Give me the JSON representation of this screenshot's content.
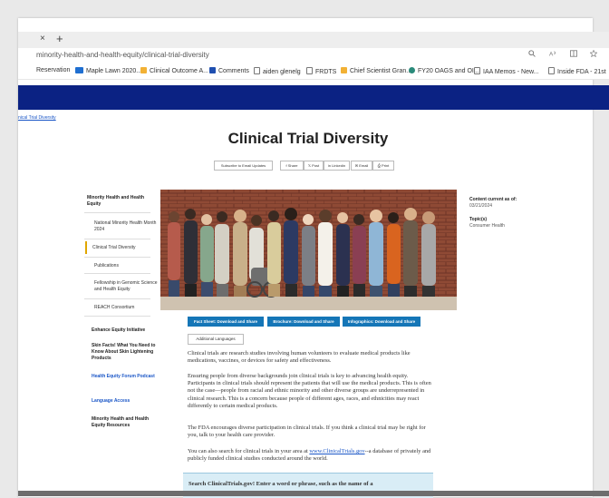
{
  "browser": {
    "close_glyph": "×",
    "new_tab_glyph": "+",
    "url": "minority-health-and-health-equity/clinical-trial-diversity",
    "toolbar_icons": [
      "search-icon",
      "read-aloud-icon",
      "split-screen-icon",
      "favorite-icon"
    ],
    "bookmarks": [
      {
        "label": "Reservation",
        "icon": "none",
        "color": ""
      },
      {
        "label": "Maple Lawn 2020...",
        "icon": "su-icon",
        "color": "#1f6fd1"
      },
      {
        "label": "Clinical Outcome A...",
        "icon": "folder-icon",
        "color": "#f2b134"
      },
      {
        "label": "Comments",
        "icon": "doc-icon",
        "color": "#1f4fb0"
      },
      {
        "label": "aiden glenelg",
        "icon": "page-icon",
        "color": "#777777"
      },
      {
        "label": "FRDTS",
        "icon": "page-icon",
        "color": "#777777"
      },
      {
        "label": "Chief Scientist Gran...",
        "icon": "folder-icon",
        "color": "#f2b134"
      },
      {
        "label": "FY20 OAGS and OI...",
        "icon": "app-icon",
        "color": "#2a8a7a"
      },
      {
        "label": "IAA Memos - New...",
        "icon": "page-icon",
        "color": "#777777"
      },
      {
        "label": "Inside FDA - 21st",
        "icon": "page-icon",
        "color": "#777777"
      }
    ]
  },
  "page": {
    "breadcrumb": "nical Trial Diversity",
    "title": "Clinical Trial Diversity",
    "share_buttons": {
      "subscribe": "Subscribe to Email Updates",
      "share": "Share",
      "post": "Post",
      "linkedin": "Linkedin",
      "email": "Email",
      "print": "Print"
    },
    "sidenav": {
      "section_title": "Minority Health and Health Equity",
      "items": [
        "National Minority Health Month 2024",
        "Clinical Trial Diversity",
        "Publications",
        "Fellowship in Genomic Science and Health Equity",
        "REACH Consortium"
      ],
      "links": [
        "Enhance Equity Initiative",
        "Skin Facts! What You Need to Know About Skin Lightening Products",
        "Health Equity Forum Podcast",
        "Language Access",
        "Minority Health and Health Equity Resources"
      ]
    },
    "meta": {
      "content_current_label": "Content current as of:",
      "content_current_date": "03/21/2024",
      "topics_label": "Topic(s)",
      "topics_value": "Consumer Health"
    },
    "download_buttons": [
      "Fact Sheet: Download and Share",
      "Brochure: Download and Share",
      "Infographics: Download and Share"
    ],
    "additional_languages": "Additional Languages",
    "paragraphs": {
      "p1": "Clinical trials are research studies involving human volunteers to evaluate medical products like medications, vaccines, or devices for safety and effectiveness.",
      "p2": "Ensuring people from diverse backgrounds join clinical trials is key to advancing health equity. Participants in clinical trials should represent the patients that will use the medical products. This is often not the case—people from racial and ethnic minority and other diverse groups are underrepresented in clinical research. This is a concern because people of different ages, races, and ethnicities may react differently to certain medical products.",
      "p3": "The FDA encourages diverse participation in clinical trials. If you think a clinical trial may be right for you, talk to your health care provider.",
      "p4_pre": "You can also search for clinical trials in your area at ",
      "p4_link": "www.ClinicalTrials.gov",
      "p4_post": "--a database of privately and publicly funded clinical studies conducted around the world."
    },
    "search_prompt": "Search ClinicalTrials.gov! Enter a word or phrase, such as the name of a"
  }
}
